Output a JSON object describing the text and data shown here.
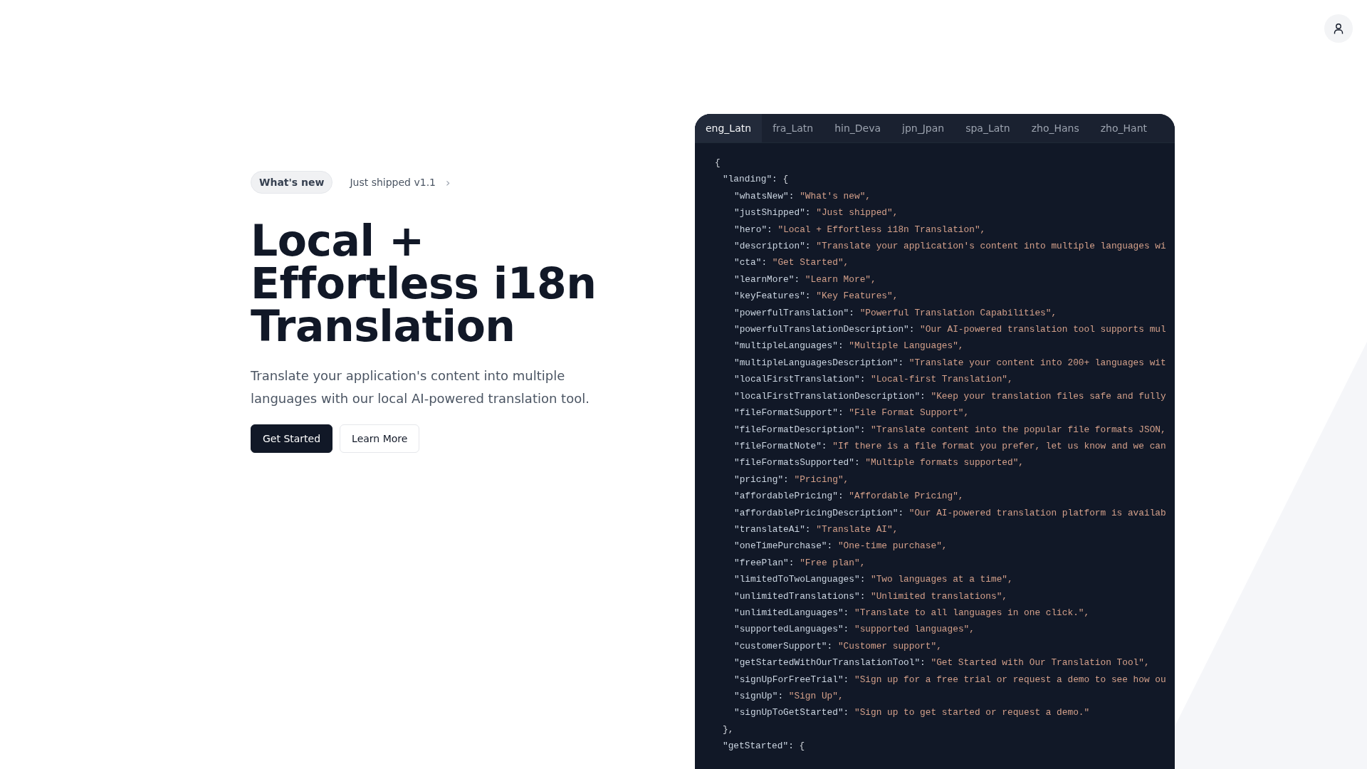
{
  "hero": {
    "badge": "What's new",
    "announcement": "Just shipped v1.1",
    "announcement_arrow": "›",
    "title": "Local + Effortless i18n Translation",
    "description": "Translate your application's content into multiple languages with our local AI-powered translation tool.",
    "buttons": [
      {
        "label": "Get Started",
        "kind": "primary"
      },
      {
        "label": "Learn More",
        "kind": "secondary"
      }
    ]
  },
  "code_panel": {
    "tabs": [
      {
        "label": "eng_Latn",
        "selected": true
      },
      {
        "label": "fra_Latn",
        "selected": false
      },
      {
        "label": "hin_Deva",
        "selected": false
      },
      {
        "label": "jpn_Jpan",
        "selected": false
      },
      {
        "label": "spa_Latn",
        "selected": false
      },
      {
        "label": "zho_Hans",
        "selected": false
      },
      {
        "label": "zho_Hant",
        "selected": false
      }
    ],
    "open": "{",
    "sections": [
      {
        "key": "\"landing\":",
        "brace": "{",
        "close": "},",
        "entries": [
          {
            "key": "\"whatsNew\":",
            "value": "\"What's new\","
          },
          {
            "key": "\"justShipped\":",
            "value": "\"Just shipped\","
          },
          {
            "key": "\"hero\":",
            "value": "\"Local + Effortless i18n Translation\","
          },
          {
            "key": "\"description\":",
            "value": "\"Translate your application's content into multiple languages wi"
          },
          {
            "key": "\"cta\":",
            "value": "\"Get Started\","
          },
          {
            "key": "\"learnMore\":",
            "value": "\"Learn More\","
          },
          {
            "key": "\"keyFeatures\":",
            "value": "\"Key Features\","
          },
          {
            "key": "\"powerfulTranslation\":",
            "value": "\"Powerful Translation Capabilities\","
          },
          {
            "key": "\"powerfulTranslationDescription\":",
            "value": "\"Our AI-powered translation tool supports mul"
          },
          {
            "key": "\"multipleLanguages\":",
            "value": "\"Multiple Languages\","
          },
          {
            "key": "\"multipleLanguagesDescription\":",
            "value": "\"Translate your content into 200+ languages wit"
          },
          {
            "key": "\"localFirstTranslation\":",
            "value": "\"Local-first Translation\","
          },
          {
            "key": "\"localFirstTranslationDescription\":",
            "value": "\"Keep your translation files safe and fully"
          },
          {
            "key": "\"fileFormatSupport\":",
            "value": "\"File Format Support\","
          },
          {
            "key": "\"fileFormatDescription\":",
            "value": "\"Translate content into the popular file formats JSON,"
          },
          {
            "key": "\"fileFormatNote\":",
            "value": "\"If there is a file format you prefer, let us know and we can"
          },
          {
            "key": "\"fileFormatsSupported\":",
            "value": "\"Multiple formats supported\","
          },
          {
            "key": "\"pricing\":",
            "value": "\"Pricing\","
          },
          {
            "key": "\"affordablePricing\":",
            "value": "\"Affordable Pricing\","
          },
          {
            "key": "\"affordablePricingDescription\":",
            "value": "\"Our AI-powered translation platform is availab"
          },
          {
            "key": "\"translateAi\":",
            "value": "\"Translate AI\","
          },
          {
            "key": "\"oneTimePurchase\":",
            "value": "\"One-time purchase\","
          },
          {
            "key": "\"freePlan\":",
            "value": "\"Free plan\","
          },
          {
            "key": "\"limitedToTwoLanguages\":",
            "value": "\"Two languages at a time\","
          },
          {
            "key": "\"unlimitedTranslations\":",
            "value": "\"Unlimited translations\","
          },
          {
            "key": "\"unlimitedLanguages\":",
            "value": "\"Translate to all languages in one click.\","
          },
          {
            "key": "\"supportedLanguages\":",
            "value": "\"supported languages\","
          },
          {
            "key": "\"customerSupport\":",
            "value": "\"Customer support\","
          },
          {
            "key": "\"getStartedWithOurTranslationTool\":",
            "value": "\"Get Started with Our Translation Tool\","
          },
          {
            "key": "\"signUpForFreeTrial\":",
            "value": "\"Sign up for a free trial or request a demo to see how ou"
          },
          {
            "key": "\"signUp\":",
            "value": "\"Sign Up\","
          },
          {
            "key": "\"signUpToGetStarted\":",
            "value": "\"Sign up to get started or request a demo.\""
          }
        ]
      },
      {
        "key": "\"getStarted\":",
        "brace": "{"
      }
    ]
  }
}
